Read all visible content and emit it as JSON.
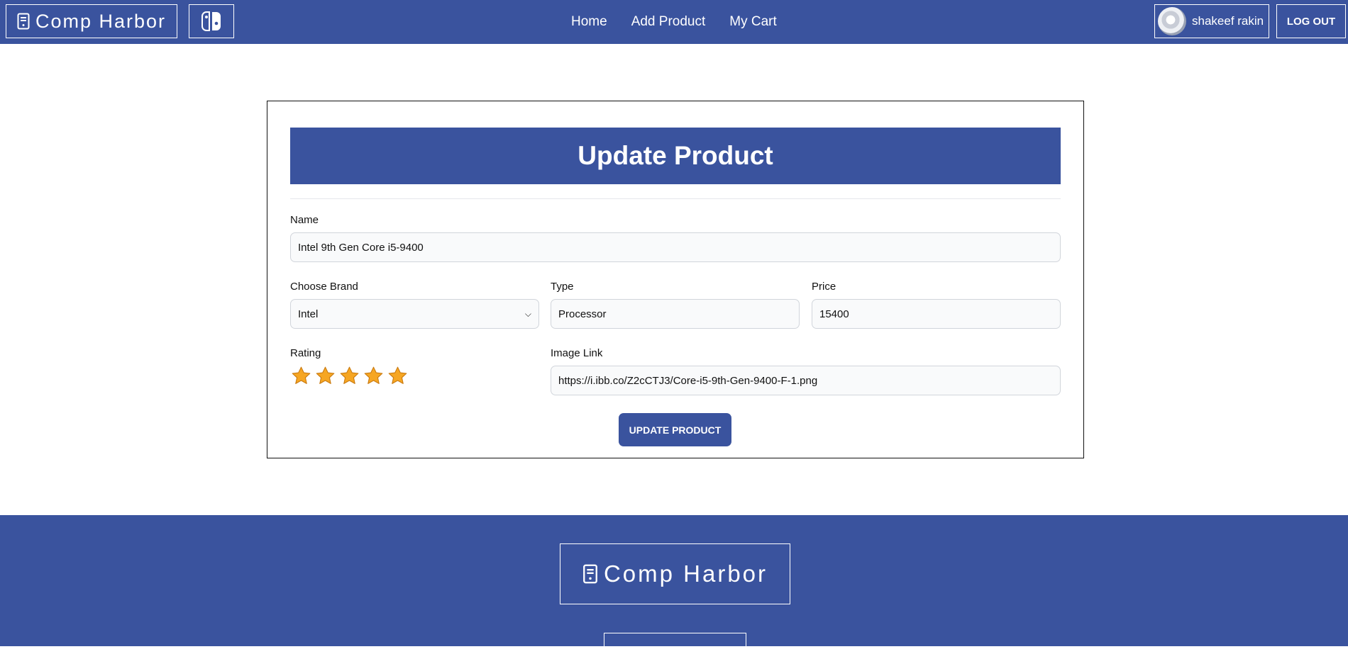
{
  "navbar": {
    "brand": "Comp Harbor",
    "links": [
      "Home",
      "Add Product",
      "My Cart"
    ],
    "user_name": "shakeef rakin",
    "logout_label": "LOG OUT"
  },
  "form": {
    "title": "Update Product",
    "name_label": "Name",
    "name_value": "Intel 9th Gen Core i5-9400",
    "brand_label": "Choose Brand",
    "brand_value": "Intel",
    "type_label": "Type",
    "type_value": "Processor",
    "price_label": "Price",
    "price_value": "15400",
    "rating_label": "Rating",
    "rating_value": 5,
    "rating_max": 5,
    "image_label": "Image Link",
    "image_value": "https://i.ibb.co/Z2cCTJ3/Core-i5-9th-Gen-9400-F-1.png",
    "submit_label": "UPDATE PRODUCT"
  },
  "footer": {
    "brand": "Comp Harbor"
  },
  "colors": {
    "primary": "#3a539e",
    "star": "#f6a623"
  }
}
